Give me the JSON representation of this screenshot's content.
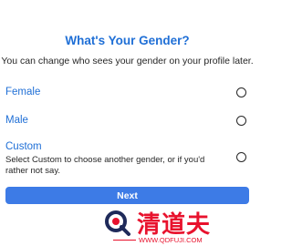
{
  "colors": {
    "accent": "#1f6fd6",
    "button": "#3d7be6",
    "watermark": "#e8122d"
  },
  "header": {
    "title": "What's Your Gender?",
    "subtitle": "You can change who sees your gender on your profile later."
  },
  "options": [
    {
      "label": "Female",
      "selected": false
    },
    {
      "label": "Male",
      "selected": false
    },
    {
      "label": "Custom",
      "description": "Select Custom to choose another gender, or if you'd rather not say.",
      "selected": false
    }
  ],
  "actions": {
    "next_label": "Next"
  },
  "watermark": {
    "text": "清道夫",
    "url": "WWW.QDFUJI.COM"
  }
}
